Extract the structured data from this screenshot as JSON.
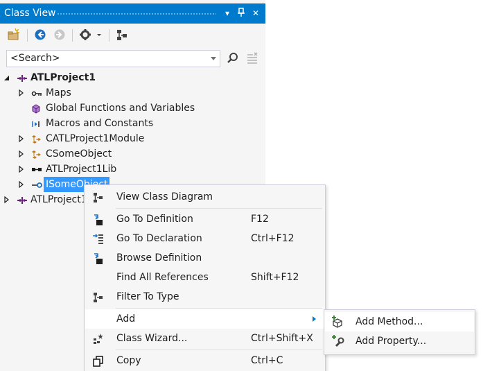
{
  "panel": {
    "title": "Class View",
    "pin_glyph": "⊥",
    "close_glyph": "✕",
    "dropdown_glyph": "▾"
  },
  "toolbar": {
    "items": [
      "new-folder-icon",
      "back-icon",
      "forward-icon",
      "settings-icon",
      "settings-dropdown-icon",
      "class-diagram-icon"
    ]
  },
  "search": {
    "placeholder": "<Search>"
  },
  "tree": {
    "root": "ATLProject1",
    "children": [
      {
        "label": "Maps",
        "icon": "map-icon",
        "expandable": true
      },
      {
        "label": "Global Functions and Variables",
        "icon": "global-icon",
        "expandable": false
      },
      {
        "label": "Macros and Constants",
        "icon": "macro-icon",
        "expandable": false
      },
      {
        "label": "CATLProject1Module",
        "icon": "class-icon",
        "expandable": true
      },
      {
        "label": "CSomeObject",
        "icon": "class-icon",
        "expandable": true
      },
      {
        "label": "ATLProject1Lib",
        "icon": "library-icon",
        "expandable": true
      },
      {
        "label": "ISomeObject",
        "icon": "interface-icon",
        "expandable": true,
        "selected": true
      }
    ],
    "second_root": "ATLProject1"
  },
  "context_menu": {
    "items": [
      {
        "label": "View Class Diagram",
        "shortcut": ""
      },
      {
        "label": "Go To Definition",
        "shortcut": "F12"
      },
      {
        "label": "Go To Declaration",
        "shortcut": "Ctrl+F12"
      },
      {
        "label": "Browse Definition",
        "shortcut": ""
      },
      {
        "label": "Find All References",
        "shortcut": "Shift+F12"
      },
      {
        "label": "Filter To Type",
        "shortcut": ""
      },
      {
        "label": "Add",
        "shortcut": ""
      },
      {
        "label": "Class Wizard...",
        "shortcut": "Ctrl+Shift+X"
      },
      {
        "label": "Copy",
        "shortcut": "Ctrl+C"
      }
    ]
  },
  "submenu": {
    "items": [
      {
        "label": "Add Method..."
      },
      {
        "label": "Add Property..."
      }
    ]
  },
  "colors": {
    "accent": "#007acc",
    "selection": "#3399ff",
    "class_icon": "#c27d1a",
    "interface_icon": "#1e1e1e"
  }
}
